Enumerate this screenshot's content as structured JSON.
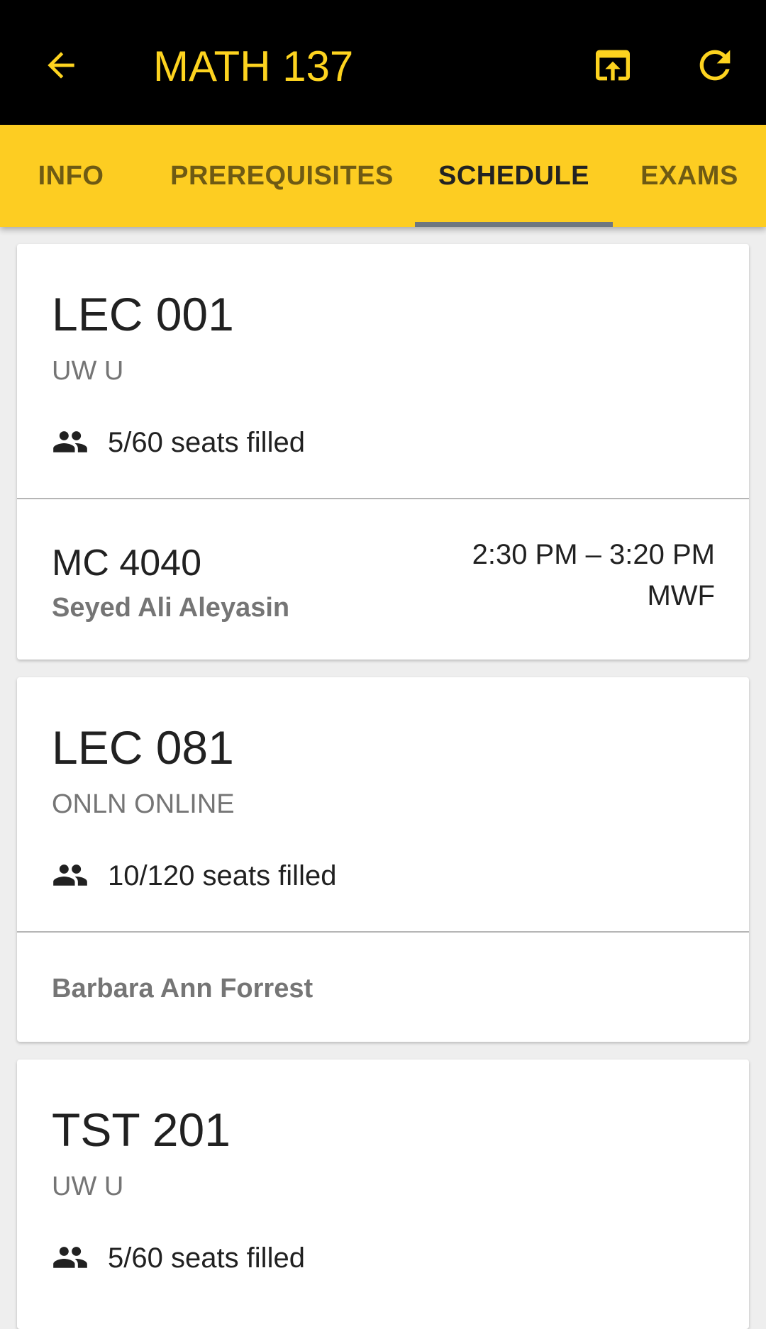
{
  "app_bar": {
    "title": "MATH 137",
    "back_icon": "arrow-back-icon",
    "open_icon": "open-in-browser-icon",
    "refresh_icon": "refresh-icon"
  },
  "tabs": [
    {
      "label": "INFO",
      "active": false
    },
    {
      "label": "PREREQUISITES",
      "active": false
    },
    {
      "label": "SCHEDULE",
      "active": true
    },
    {
      "label": "EXAMS",
      "active": false
    }
  ],
  "sections": [
    {
      "name": "LEC 001",
      "campus": "UW U",
      "seats": "5/60 seats filled",
      "room": "MC 4040",
      "instructor": "Seyed Ali Aleyasin",
      "time": "2:30 PM – 3:20 PM",
      "days": "MWF"
    },
    {
      "name": "LEC 081",
      "campus": "ONLN ONLINE",
      "seats": "10/120 seats filled",
      "instructor": "Barbara Ann Forrest"
    },
    {
      "name": "TST 201",
      "campus": "UW U",
      "seats": "5/60 seats filled"
    }
  ],
  "colors": {
    "app_bar_bg": "#000000",
    "accent_yellow": "#fdd31f",
    "tab_bar_bg": "#fdcd22",
    "tab_indicator": "#6e7780",
    "background": "#eeeeee"
  }
}
